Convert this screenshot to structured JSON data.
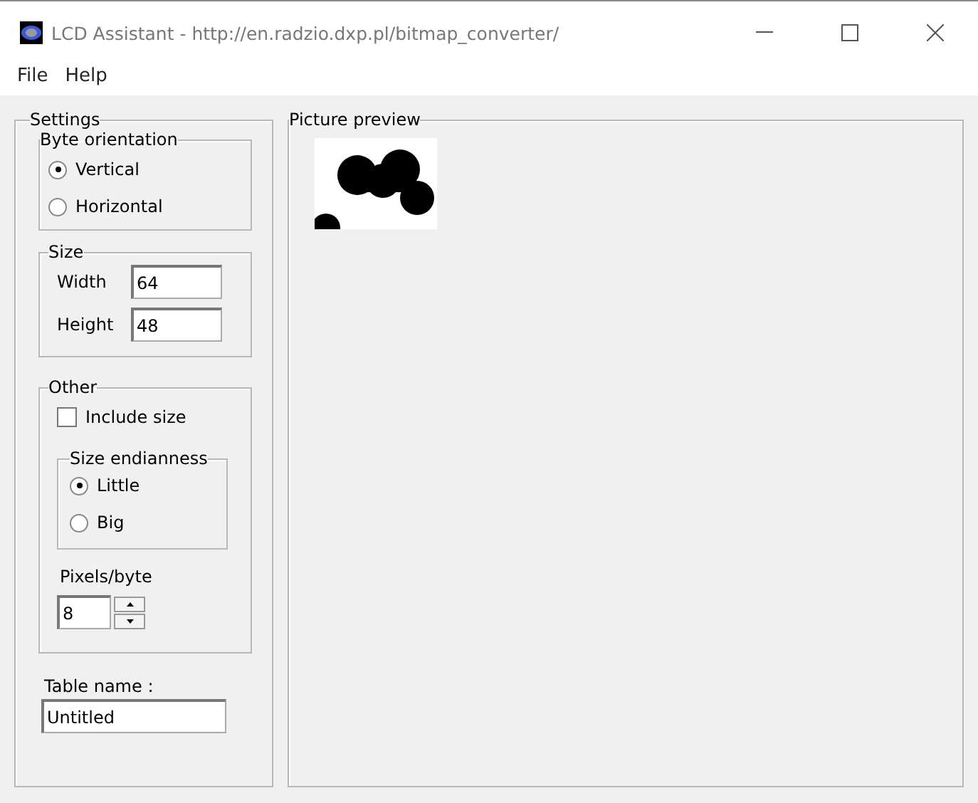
{
  "window": {
    "title": "LCD Assistant -  http://en.radzio.dxp.pl/bitmap_converter/"
  },
  "menu": [
    "File",
    "Help"
  ],
  "settings": {
    "title": "Settings",
    "byte_orientation": {
      "title": "Byte orientation",
      "options": [
        {
          "label": "Vertical",
          "selected": true
        },
        {
          "label": "Horizontal",
          "selected": false
        }
      ]
    },
    "size": {
      "title": "Size",
      "fields": [
        {
          "label": "Width",
          "value": "64"
        },
        {
          "label": "Height",
          "value": "48"
        }
      ]
    },
    "other": {
      "title": "Other",
      "include_size": {
        "label": "Include size",
        "checked": false
      },
      "size_endianness": {
        "title": "Size endianness",
        "options": [
          {
            "label": "Little",
            "selected": true
          },
          {
            "label": "Big",
            "selected": false
          }
        ]
      },
      "pixels_per_byte": {
        "label": "Pixels/byte",
        "value": "8"
      }
    },
    "table_name": {
      "label": "Table name :",
      "value": "Untitled"
    }
  },
  "preview": {
    "title": "Picture preview"
  }
}
